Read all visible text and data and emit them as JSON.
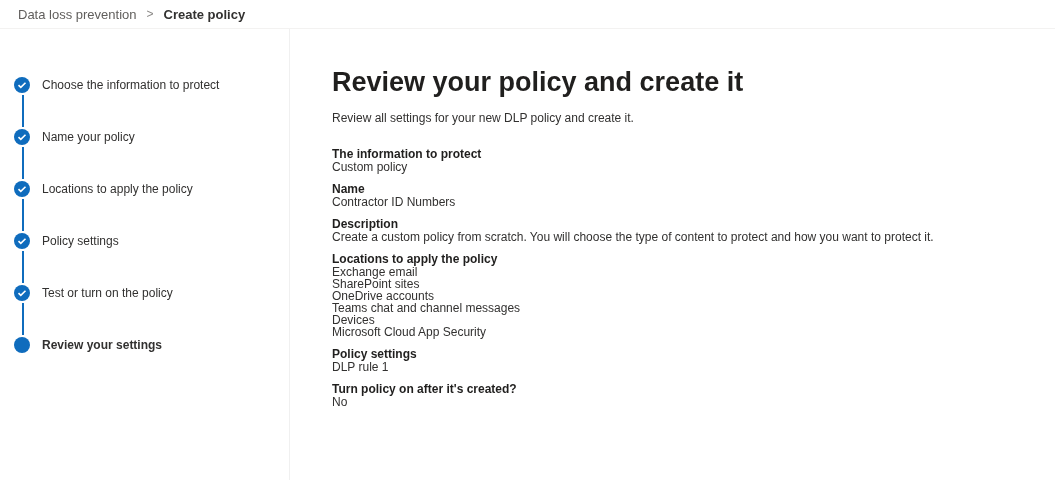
{
  "breadcrumb": [
    {
      "label": "Data loss prevention",
      "current": false
    },
    {
      "label": "Create policy",
      "current": true
    }
  ],
  "breadcrumb_separator": ">",
  "steps": [
    {
      "label": "Choose the information to protect",
      "completed": true,
      "selected": false
    },
    {
      "label": "Name your policy",
      "completed": true,
      "selected": false
    },
    {
      "label": "Locations to apply the policy",
      "completed": true,
      "selected": false
    },
    {
      "label": "Policy settings",
      "completed": true,
      "selected": false
    },
    {
      "label": "Test or turn on the policy",
      "completed": true,
      "selected": false
    },
    {
      "label": "Review your settings",
      "completed": false,
      "selected": true
    }
  ],
  "main": {
    "title": "Review your policy and create it",
    "intro": "Review all settings for your new DLP policy and create it.",
    "sections": [
      {
        "heading": "The information to protect",
        "values": [
          "Custom policy"
        ]
      },
      {
        "heading": "Name",
        "values": [
          "Contractor ID Numbers"
        ]
      },
      {
        "heading": "Description",
        "values": [
          "Create a custom policy from scratch. You will choose the type of content to protect and how you want to protect it."
        ]
      },
      {
        "heading": "Locations to apply the policy",
        "values": [
          "Exchange email",
          "SharePoint sites",
          "OneDrive accounts",
          "Teams chat and channel messages",
          "Devices",
          "Microsoft Cloud App Security"
        ]
      },
      {
        "heading": "Policy settings",
        "values": [
          "DLP rule 1"
        ]
      },
      {
        "heading": "Turn policy on after it's created?",
        "values": [
          "No"
        ]
      }
    ]
  }
}
